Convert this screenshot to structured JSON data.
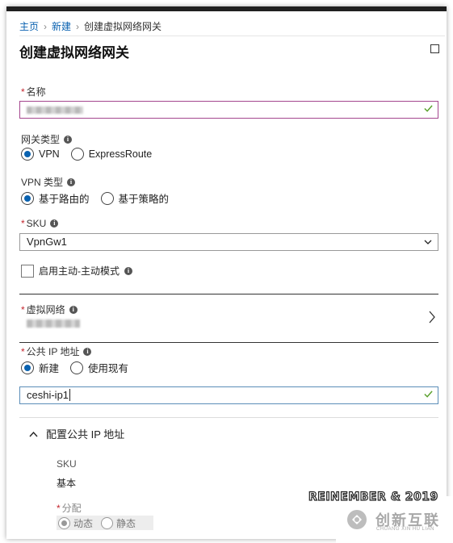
{
  "breadcrumb": {
    "items": [
      "主页",
      "新建"
    ],
    "current": "创建虚拟网络网关"
  },
  "page": {
    "title": "创建虚拟网络网关"
  },
  "form": {
    "name": {
      "label": "名称",
      "value": "g_ _"
    },
    "gateway_type": {
      "label": "网关类型",
      "options": [
        "VPN",
        "ExpressRoute"
      ],
      "selected": "VPN"
    },
    "vpn_type": {
      "label": "VPN 类型",
      "options": [
        "基于路由的",
        "基于策略的"
      ],
      "selected": "基于路由的"
    },
    "sku": {
      "label": "SKU",
      "value": "VpnGw1"
    },
    "active_active": {
      "label": "启用主动-主动模式",
      "checked": false
    },
    "vnet": {
      "label": "虚拟网络"
    },
    "public_ip": {
      "label": "公共 IP 地址",
      "options": [
        "新建",
        "使用现有"
      ],
      "selected": "新建",
      "value": "ceshi-ip1"
    },
    "configure_ip": {
      "header": "配置公共 IP 地址",
      "sku_label": "SKU",
      "sku_value": "基本",
      "assignment_label": "分配",
      "assignment_options": [
        "动态",
        "静态"
      ],
      "assignment_selected": "动态"
    }
  },
  "watermark": {
    "text": "REINEMBER & 2019",
    "logo_cn": "创新互联",
    "logo_en": "CHUANG XIN HU LIAN"
  },
  "colors": {
    "accent": "#0a62b0",
    "required": "#c4262e",
    "valid": "#5aa02c"
  }
}
